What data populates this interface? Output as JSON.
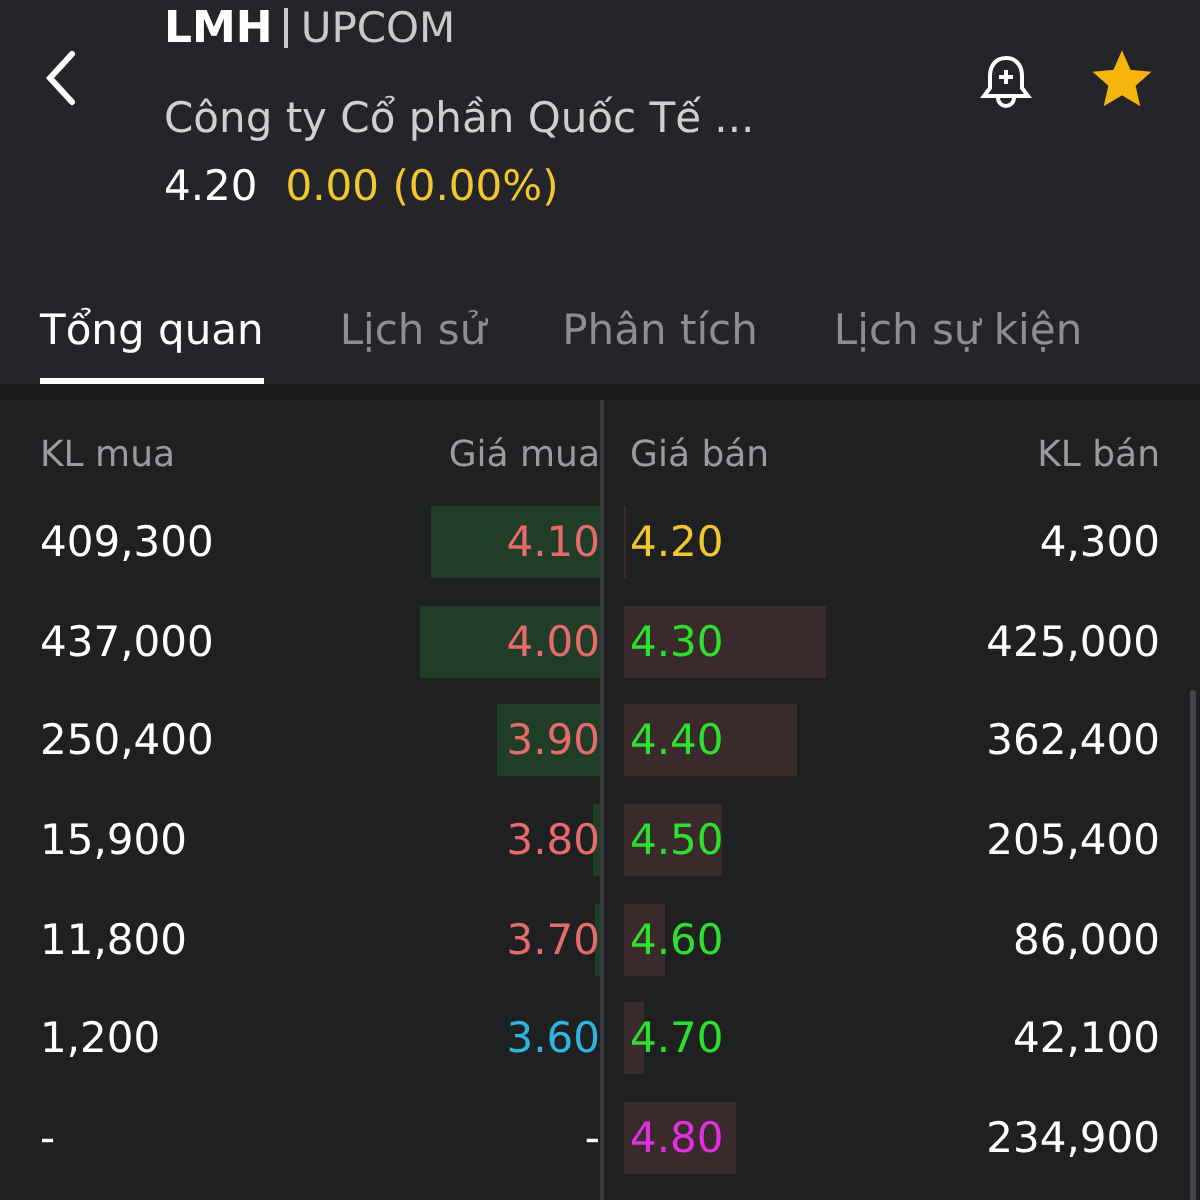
{
  "header": {
    "ticker": "LMH",
    "exchange": "UPCOM",
    "company": "Công ty Cổ phần Quốc Tế ...",
    "price": "4.20",
    "change": "0.00 (0.00%)",
    "starred": true
  },
  "tabs": [
    {
      "label": "Tổng quan",
      "selected": true
    },
    {
      "label": "Lịch sử",
      "selected": false
    },
    {
      "label": "Phân tích",
      "selected": false
    },
    {
      "label": "Lịch sự kiện",
      "selected": false
    }
  ],
  "order_book": {
    "columns": [
      "KL mua",
      "Giá mua",
      "Giá bán",
      "KL bán"
    ],
    "rows": [
      {
        "bid": {
          "volume": "409,300",
          "price": "4.10",
          "color": "#e86a6a"
        },
        "ask": {
          "price": "4.20",
          "color": "#f2c531",
          "volume": "4,300"
        }
      },
      {
        "bid": {
          "volume": "437,000",
          "price": "4.00",
          "color": "#e86a6a"
        },
        "ask": {
          "price": "4.30",
          "color": "#2ee02e",
          "volume": "425,000"
        }
      },
      {
        "bid": {
          "volume": "250,400",
          "price": "3.90",
          "color": "#e86a6a"
        },
        "ask": {
          "price": "4.40",
          "color": "#2ee02e",
          "volume": "362,400"
        }
      },
      {
        "bid": {
          "volume": "15,900",
          "price": "3.80",
          "color": "#e86a6a"
        },
        "ask": {
          "price": "4.50",
          "color": "#2ee02e",
          "volume": "205,400"
        }
      },
      {
        "bid": {
          "volume": "11,800",
          "price": "3.70",
          "color": "#e86a6a"
        },
        "ask": {
          "price": "4.60",
          "color": "#2ee02e",
          "volume": "86,000"
        }
      },
      {
        "bid": {
          "volume": "1,200",
          "price": "3.60",
          "color": "#2fb4e0"
        },
        "ask": {
          "price": "4.70",
          "color": "#2ee02e",
          "volume": "42,100"
        }
      },
      {
        "bid": {
          "volume": "-",
          "price": "-",
          "color": "#ffffff"
        },
        "ask": {
          "price": "4.80",
          "color": "#e030e0",
          "volume": "234,900"
        }
      }
    ]
  }
}
